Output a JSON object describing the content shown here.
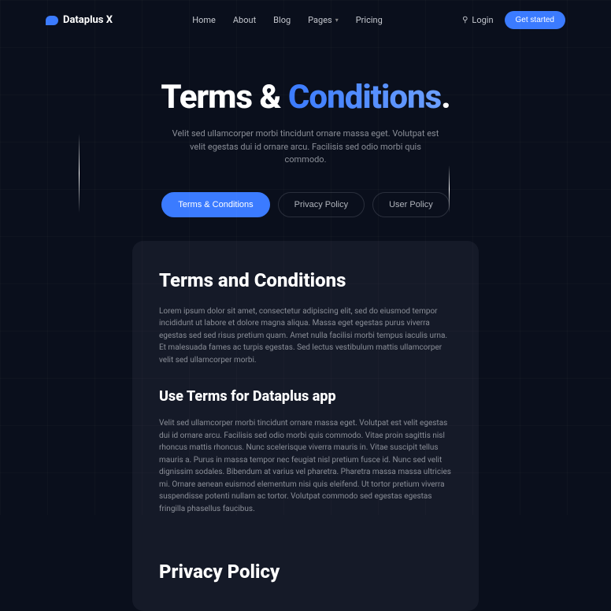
{
  "brand": {
    "name": "Dataplus X"
  },
  "nav": {
    "links": [
      {
        "label": "Home"
      },
      {
        "label": "About"
      },
      {
        "label": "Blog"
      },
      {
        "label": "Pages",
        "dropdown": true
      },
      {
        "label": "Pricing"
      }
    ],
    "login": "Login",
    "cta": "Get started"
  },
  "hero": {
    "title_pre": "Terms & ",
    "title_accent": "Conditions",
    "title_suffix": ".",
    "subtitle": "Velit sed ullamcorper morbi tincidunt ornare massa eget. Volutpat est velit egestas dui id ornare arcu. Facilisis sed odio morbi quis commodo."
  },
  "tabs": [
    {
      "label": "Terms & Conditions",
      "active": true
    },
    {
      "label": "Privacy Policy",
      "active": false
    },
    {
      "label": "User Policy",
      "active": false
    }
  ],
  "content": {
    "h1": "Terms and Conditions",
    "p1": "Lorem ipsum dolor sit amet, consectetur adipiscing elit, sed do eiusmod tempor incididunt ut labore et dolore magna aliqua. Massa eget egestas purus viverra egestas sed sed risus pretium quam. Amet nulla facilisi morbi tempus iaculis urna. Et malesuada fames ac turpis egestas. Sed lectus vestibulum mattis ullamcorper velit sed ullamcorper morbi.",
    "h2": "Use Terms for Dataplus app",
    "p2": "Velit sed ullamcorper morbi tincidunt ornare massa eget. Volutpat est velit egestas dui id ornare arcu. Facilisis sed odio morbi quis commodo. Vitae proin sagittis nisl rhoncus mattis rhoncus. Nunc scelerisque viverra mauris in. Vitae suscipit tellus mauris a. Purus in massa tempor nec feugiat nisl pretium fusce id. Nunc sed velit dignissim sodales. Bibendum at varius vel pharetra. Pharetra massa massa ultricies mi. Ornare aenean euismod elementum nisi quis eleifend. Ut tortor pretium viverra suspendisse potenti nullam ac tortor. Volutpat commodo sed egestas egestas fringilla phasellus faucibus.",
    "h3": "Privacy Policy"
  }
}
